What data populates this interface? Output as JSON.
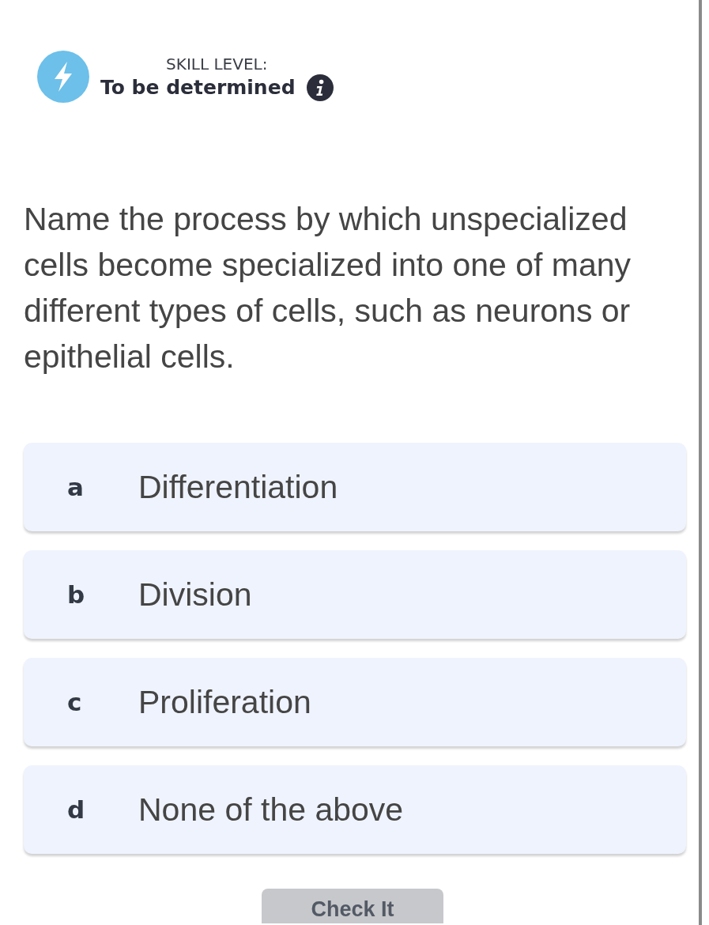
{
  "header": {
    "label": "SKILL LEVEL:",
    "value": "To be determined"
  },
  "question": "Name the process by which unspecialized cells become specialized into one of many different types of cells, such as neurons or epithelial cells.",
  "options": [
    {
      "letter": "a",
      "text": "Differentiation",
      "selected": false
    },
    {
      "letter": "b",
      "text": "Division",
      "selected": false
    },
    {
      "letter": "c",
      "text": "Proliferation",
      "selected": false
    },
    {
      "letter": "d",
      "text": "None of the above",
      "selected": false
    }
  ],
  "check_button": {
    "label": "Check It",
    "disabled": true
  }
}
